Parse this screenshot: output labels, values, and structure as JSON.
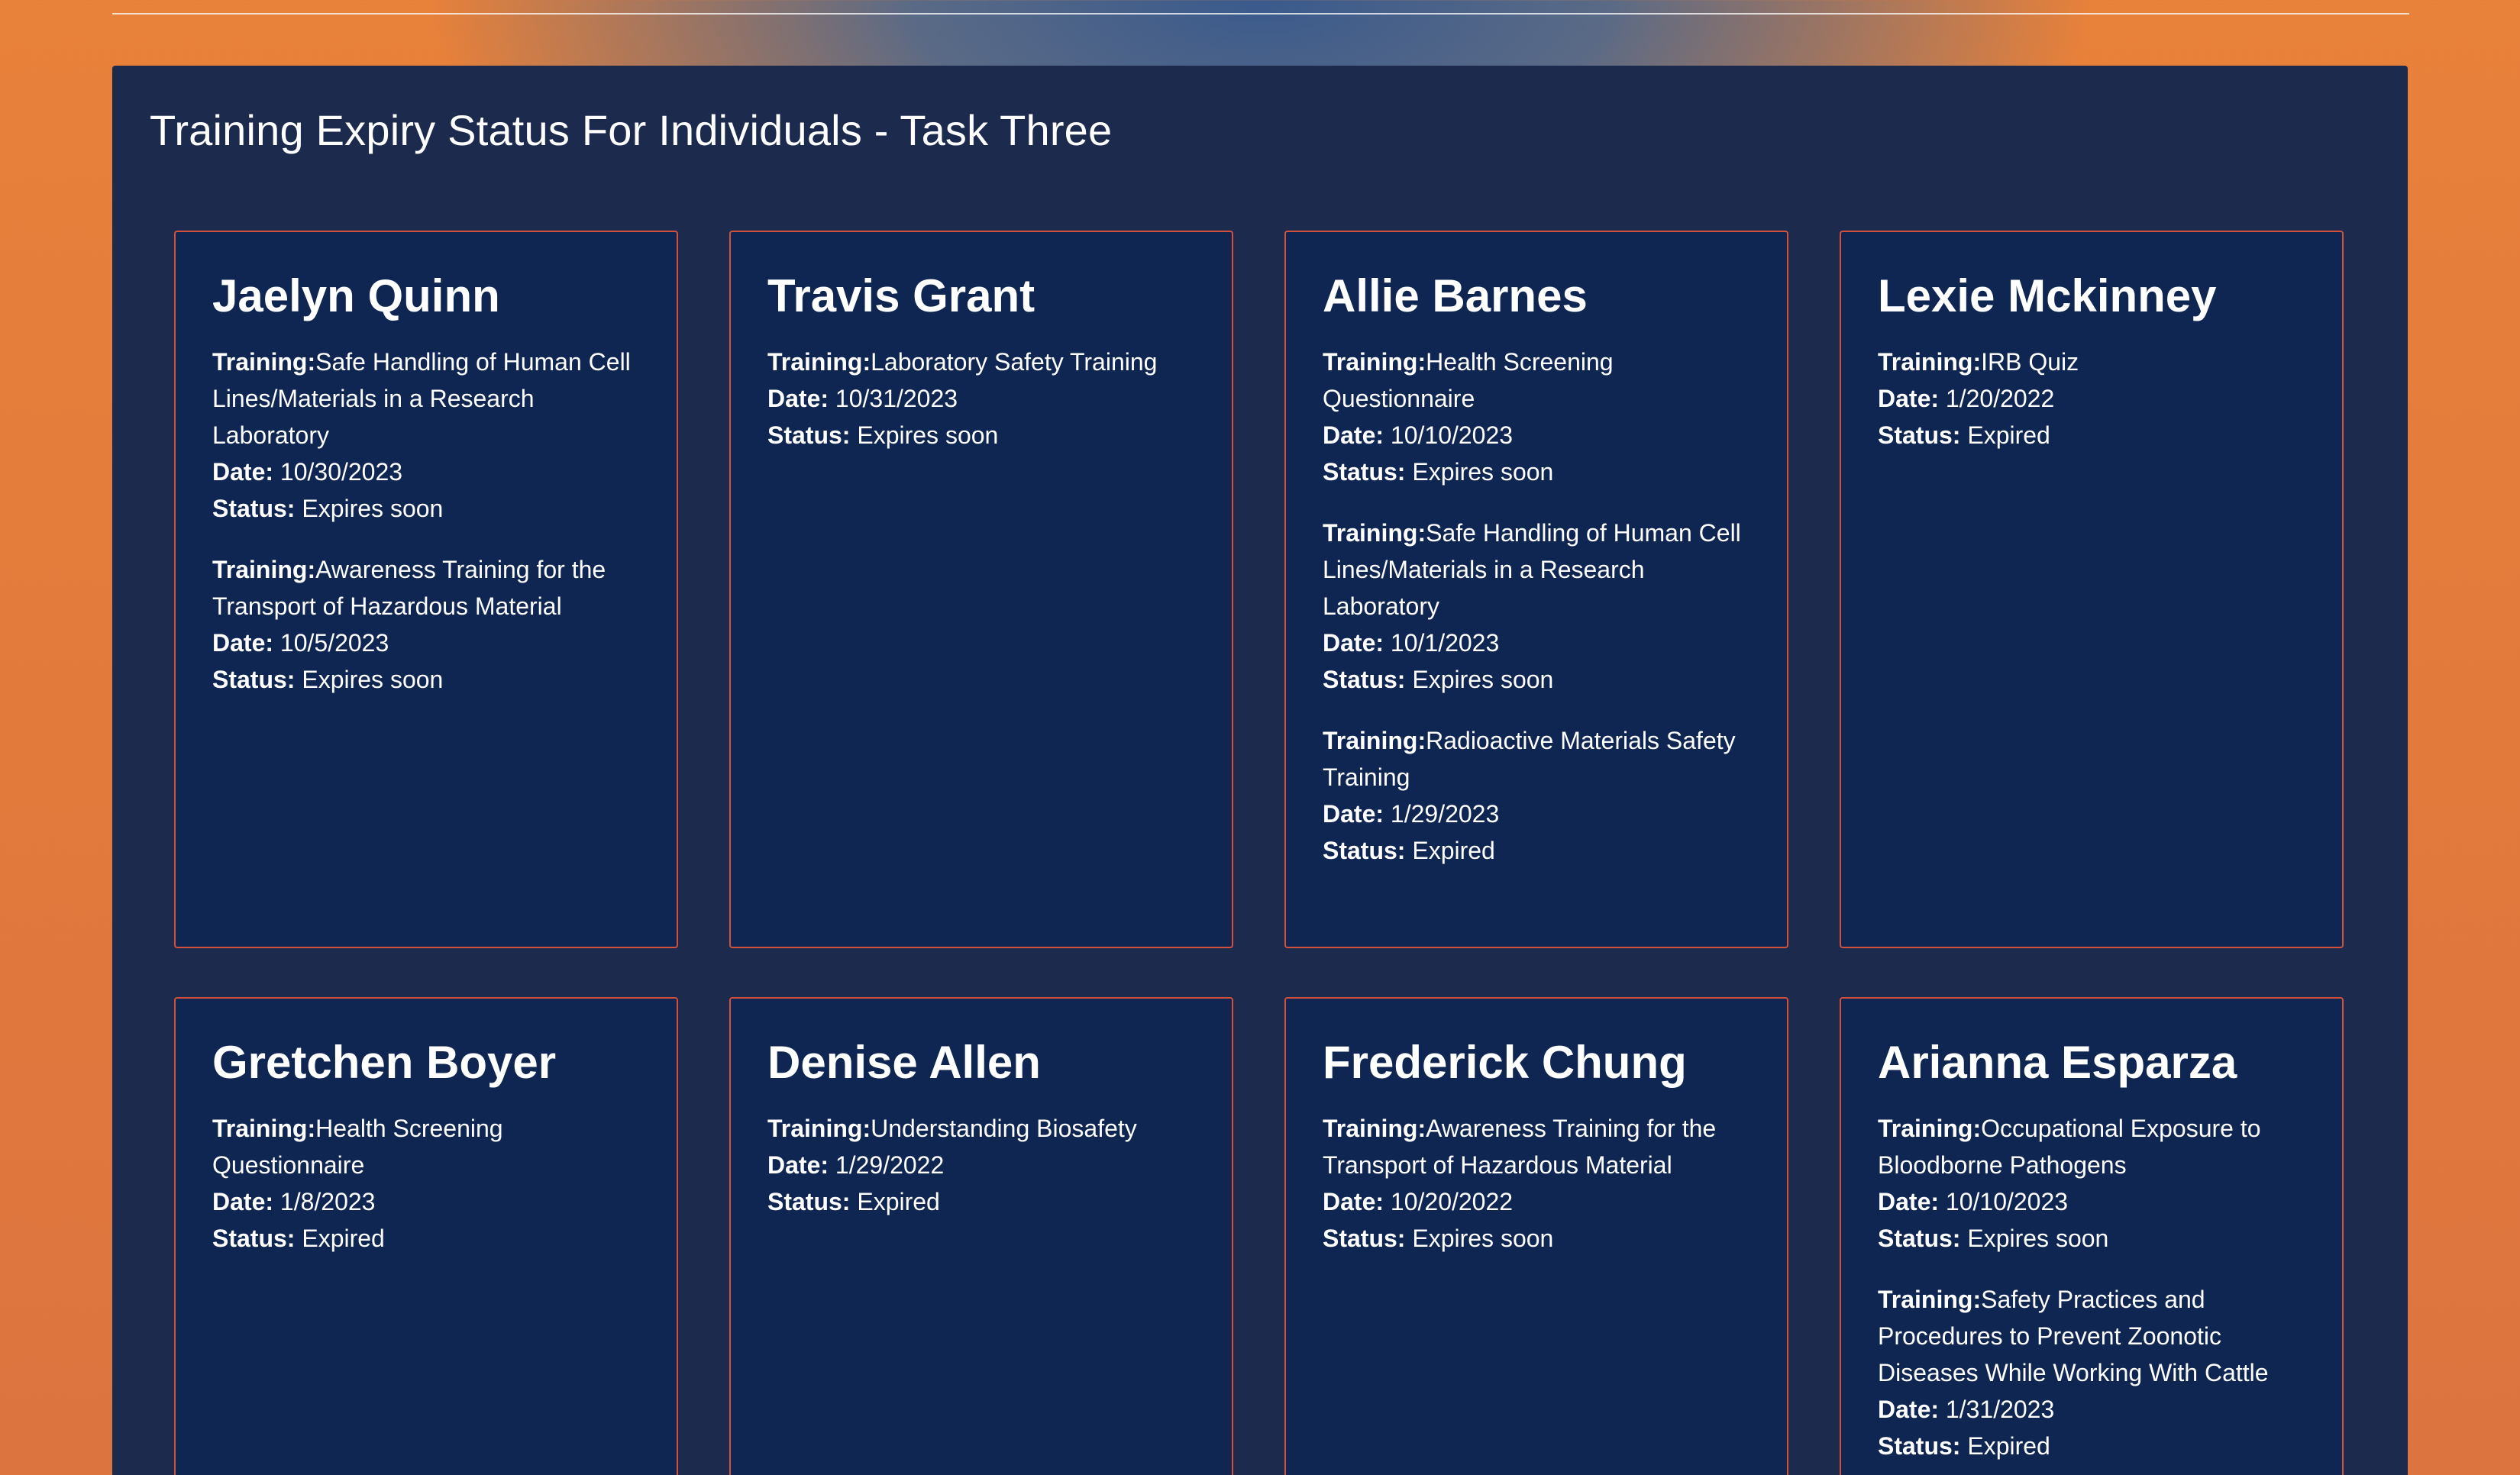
{
  "page": {
    "title": "Training Expiry Status For Individuals - Task Three"
  },
  "labels": {
    "training": "Training:",
    "date": "Date:",
    "status": "Status:"
  },
  "people": [
    {
      "name": "Jaelyn Quinn",
      "trainings": [
        {
          "training": "Safe Handling of Human Cell Lines/Materials in a Research Laboratory",
          "date": "10/30/2023",
          "status": "Expires soon"
        },
        {
          "training": "Awareness Training for the Transport of Hazardous Material",
          "date": "10/5/2023",
          "status": "Expires soon"
        }
      ]
    },
    {
      "name": "Travis Grant",
      "trainings": [
        {
          "training": "Laboratory Safety Training",
          "date": "10/31/2023",
          "status": "Expires soon"
        }
      ]
    },
    {
      "name": "Allie Barnes",
      "trainings": [
        {
          "training": "Health Screening Questionnaire",
          "date": "10/10/2023",
          "status": "Expires soon"
        },
        {
          "training": "Safe Handling of Human Cell Lines/Materials in a Research Laboratory",
          "date": "10/1/2023",
          "status": "Expires soon"
        },
        {
          "training": "Radioactive Materials Safety Training",
          "date": "1/29/2023",
          "status": "Expired"
        }
      ]
    },
    {
      "name": "Lexie Mckinney",
      "trainings": [
        {
          "training": "IRB Quiz",
          "date": "1/20/2022",
          "status": "Expired"
        }
      ]
    },
    {
      "name": "Gretchen Boyer",
      "trainings": [
        {
          "training": "Health Screening Questionnaire",
          "date": "1/8/2023",
          "status": "Expired"
        }
      ]
    },
    {
      "name": "Denise Allen",
      "trainings": [
        {
          "training": "Understanding Biosafety",
          "date": "1/29/2022",
          "status": "Expired"
        }
      ]
    },
    {
      "name": "Frederick Chung",
      "trainings": [
        {
          "training": "Awareness Training for the Transport of Hazardous Material",
          "date": "10/20/2022",
          "status": "Expires soon"
        }
      ]
    },
    {
      "name": "Arianna Esparza",
      "trainings": [
        {
          "training": "Occupational Exposure to Bloodborne Pathogens",
          "date": "10/10/2023",
          "status": "Expires soon"
        },
        {
          "training": "Safety Practices and Procedures to Prevent Zoonotic Diseases While Working With Cattle",
          "date": "1/31/2023",
          "status": "Expired"
        }
      ]
    }
  ]
}
